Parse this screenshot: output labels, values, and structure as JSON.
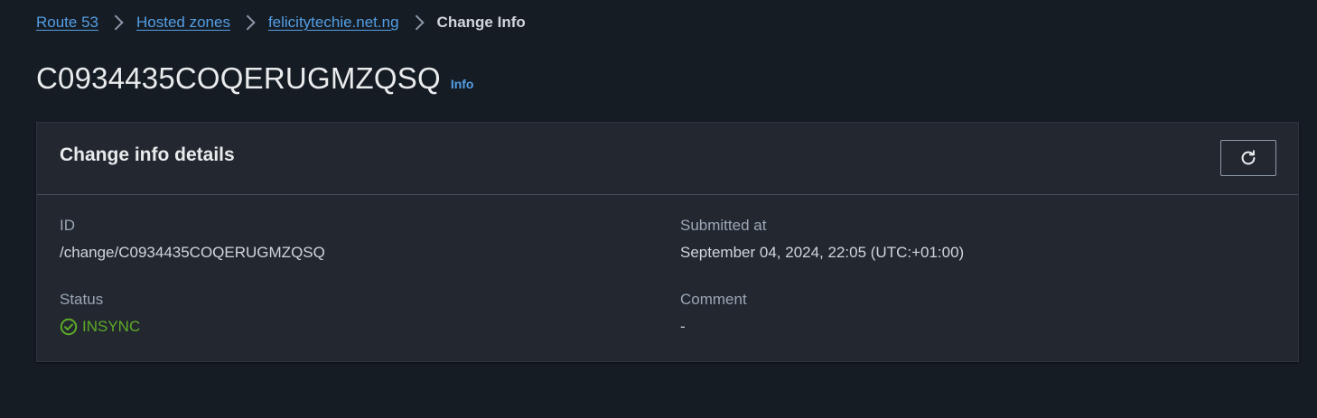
{
  "breadcrumb": {
    "items": [
      "Route 53",
      "Hosted zones",
      "felicitytechie.net.ng"
    ],
    "current": "Change Info"
  },
  "header": {
    "title": "C0934435COQERUGMZQSQ",
    "info_label": "Info"
  },
  "panel": {
    "title": "Change info details",
    "refresh_icon": "refresh-icon",
    "fields": {
      "id": {
        "label": "ID",
        "value": "/change/C0934435COQERUGMZQSQ"
      },
      "submitted_at": {
        "label": "Submitted at",
        "value": "September 04, 2024, 22:05 (UTC:+01:00)"
      },
      "status": {
        "label": "Status",
        "value": "INSYNC",
        "icon": "check-circle-icon"
      },
      "comment": {
        "label": "Comment",
        "value": "-"
      }
    }
  },
  "colors": {
    "background": "#161c24",
    "panel": "#232830",
    "link": "#539fe5",
    "success": "#5dab27"
  }
}
